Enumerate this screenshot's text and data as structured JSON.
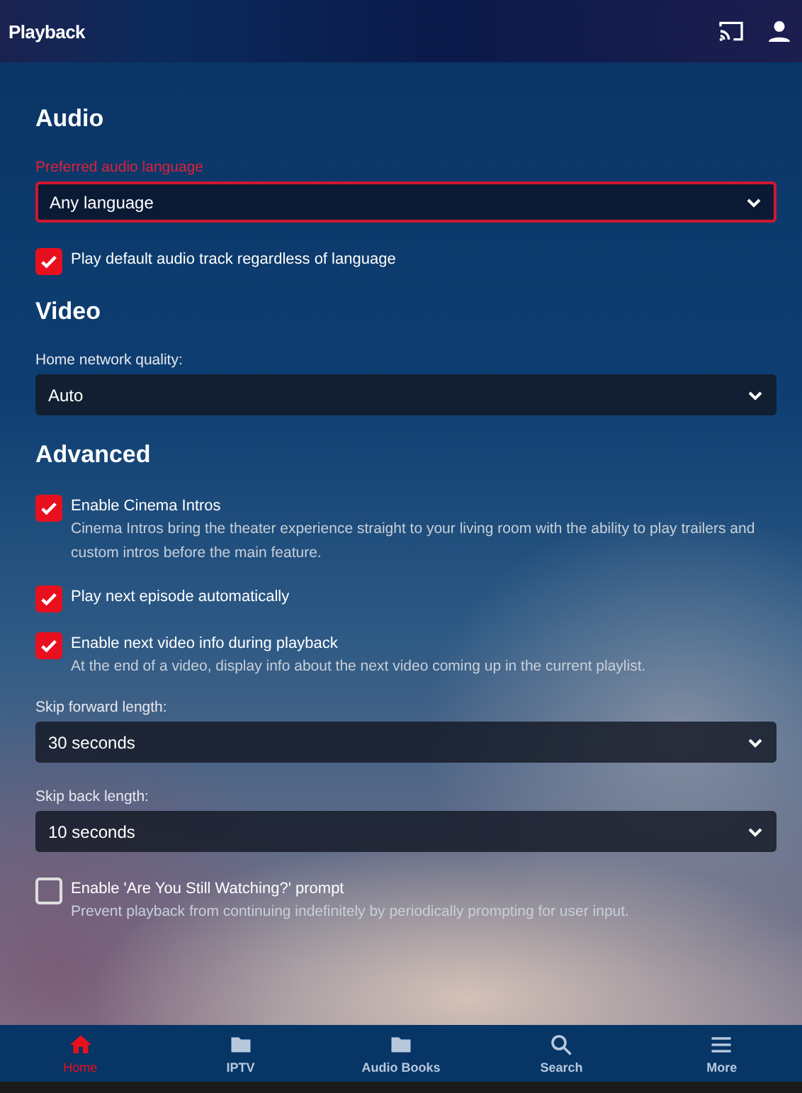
{
  "header": {
    "title": "Playback"
  },
  "sections": [
    {
      "title": "Audio",
      "items": [
        {
          "kind": "select",
          "label": "Preferred audio language",
          "value": "Any language",
          "focused": true
        },
        {
          "kind": "checkbox",
          "label": "Play default audio track regardless of language",
          "checked": true
        }
      ]
    },
    {
      "title": "Video",
      "items": [
        {
          "kind": "select",
          "label": "Home network quality:",
          "value": "Auto",
          "focused": false
        }
      ]
    },
    {
      "title": "Advanced",
      "items": [
        {
          "kind": "checkbox",
          "label": "Enable Cinema Intros",
          "checked": true,
          "description": "Cinema Intros bring the theater experience straight to your living room with the ability to play trailers and custom intros before the main feature."
        },
        {
          "kind": "checkbox",
          "label": "Play next episode automatically",
          "checked": true
        },
        {
          "kind": "checkbox",
          "label": "Enable next video info during playback",
          "checked": true,
          "description": "At the end of a video, display info about the next video coming up in the current playlist."
        },
        {
          "kind": "select",
          "label": "Skip forward length:",
          "value": "30 seconds",
          "focused": false
        },
        {
          "kind": "select",
          "label": "Skip back length:",
          "value": "10 seconds",
          "focused": false
        },
        {
          "kind": "checkbox",
          "label": "Enable 'Are You Still Watching?' prompt",
          "checked": false,
          "description": "Prevent playback from continuing indefinitely by periodically prompting for user input."
        }
      ]
    }
  ],
  "nav": [
    {
      "label": "Home",
      "kind": "home",
      "selected": true
    },
    {
      "label": "IPTV",
      "kind": "folder",
      "selected": false
    },
    {
      "label": "Audio Books",
      "kind": "folder",
      "selected": false
    },
    {
      "label": "Search",
      "kind": "search",
      "selected": false
    },
    {
      "label": "More",
      "kind": "menu",
      "selected": false
    }
  ]
}
